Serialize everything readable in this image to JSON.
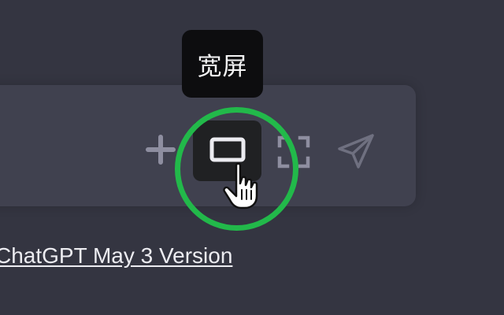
{
  "tooltip": {
    "label": "宽屏"
  },
  "composer": {
    "buttons": [
      {
        "name": "plus-button",
        "icon": "plus-icon"
      },
      {
        "name": "widescreen-button",
        "icon": "widescreen-icon",
        "state": "hovered"
      },
      {
        "name": "fullscreen-button",
        "icon": "fullscreen-icon"
      },
      {
        "name": "send-button",
        "icon": "paper-plane-icon"
      }
    ]
  },
  "footer": {
    "version_text": "ChatGPT May 3 Version"
  },
  "colors": {
    "background": "#343541",
    "input_background": "#40414f",
    "tooltip_background": "#0d0d0f",
    "highlight_ring": "#22b94a",
    "icon": "#8e8ea0"
  }
}
